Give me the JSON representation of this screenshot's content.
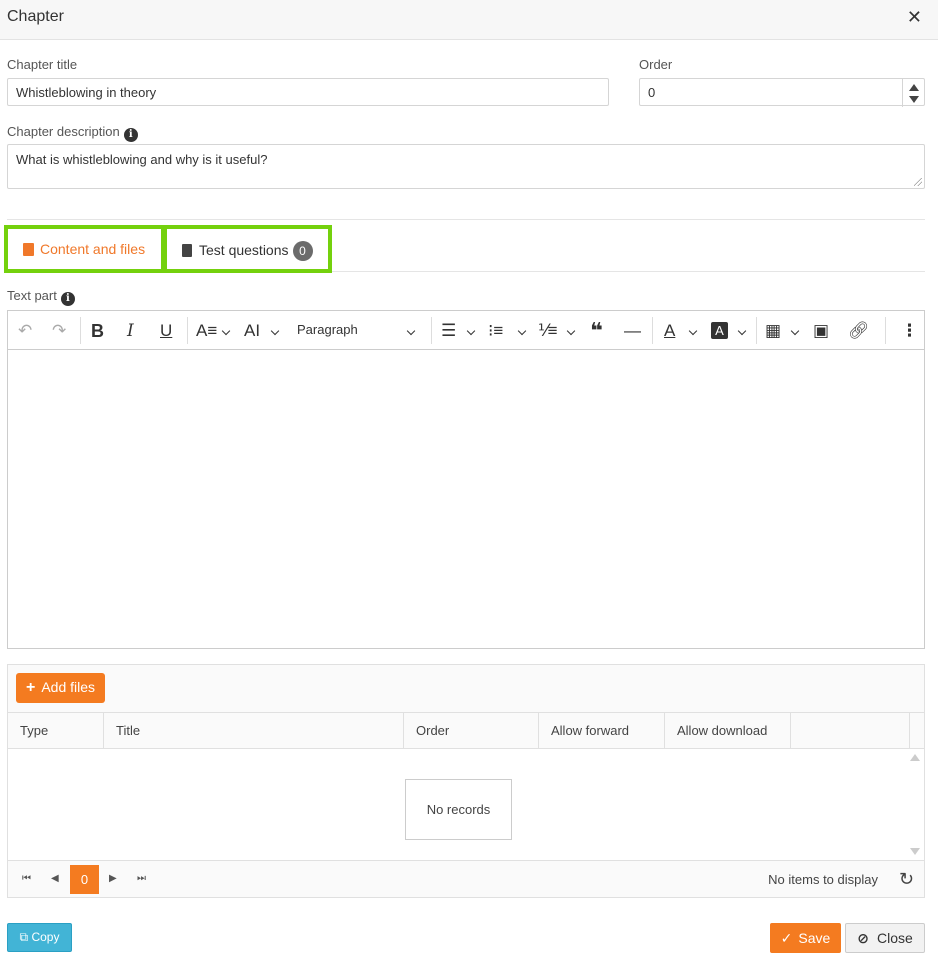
{
  "dialog": {
    "title": "Chapter",
    "close_icon": "close-icon"
  },
  "form": {
    "chapter_title_label": "Chapter title",
    "chapter_title_value": "Whistleblowing in theory",
    "order_label": "Order",
    "order_value": "0",
    "description_label": "Chapter description",
    "description_value": "What is whistleblowing and why is it useful?"
  },
  "tabs": [
    {
      "label": "Content and files",
      "active": true,
      "icon": "book-icon"
    },
    {
      "label": "Test questions",
      "badge": "0",
      "icon": "clipboard-icon"
    }
  ],
  "editor": {
    "label": "Text part",
    "paragraph_select": "Paragraph"
  },
  "files": {
    "add_label": "Add files",
    "columns": [
      "Type",
      "Title",
      "Order",
      "Allow forward",
      "Allow download"
    ],
    "empty_text": "No records",
    "pager": {
      "current_page": "0",
      "info": "No items to display"
    }
  },
  "footer": {
    "copy_label": "Copy",
    "save_label": "Save",
    "close_label": "Close"
  },
  "colors": {
    "accent": "#f47b20",
    "highlight": "#74d10d",
    "copy": "#42b4d6"
  }
}
